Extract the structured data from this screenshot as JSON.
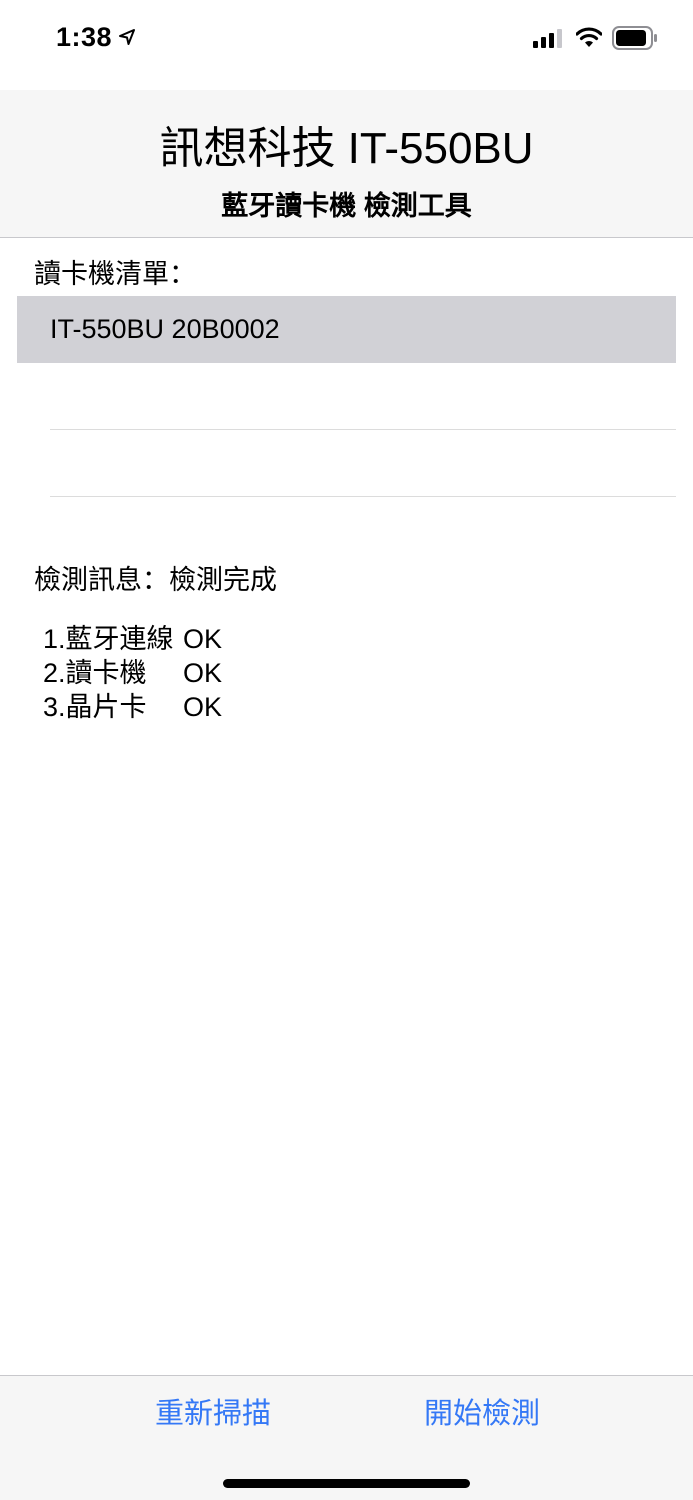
{
  "status_bar": {
    "time": "1:38",
    "icons": [
      "location-arrow-icon",
      "cellular-signal-icon",
      "wifi-icon",
      "battery-icon"
    ]
  },
  "header": {
    "title": "訊想科技 IT-550BU",
    "subtitle": "藍牙讀卡機 檢測工具"
  },
  "device_list": {
    "label": "讀卡機清單：",
    "rows": [
      {
        "text": "IT-550BU 20B0002",
        "selected": true
      },
      {
        "text": "",
        "selected": false
      },
      {
        "text": "",
        "selected": false
      }
    ]
  },
  "message": {
    "line": "檢測訊息：檢測完成",
    "checks": [
      {
        "name": "1.藍牙連線",
        "result": "OK"
      },
      {
        "name": "2.讀卡機",
        "result": "OK"
      },
      {
        "name": "3.晶片卡",
        "result": "OK"
      }
    ]
  },
  "toolbar": {
    "rescan_label": "重新掃描",
    "start_label": "開始檢測"
  },
  "colors": {
    "accent": "#3478f6",
    "selected_row": "#d1d1d6",
    "bar_background": "#f6f6f6"
  }
}
